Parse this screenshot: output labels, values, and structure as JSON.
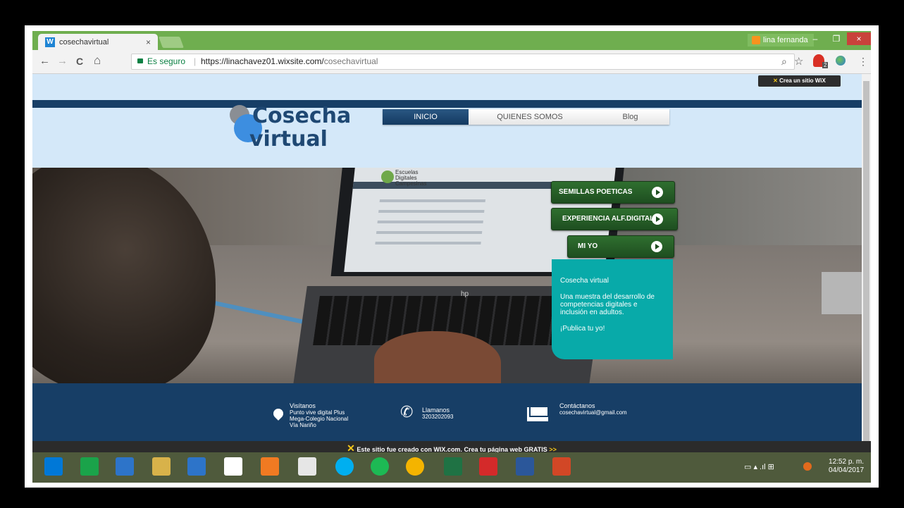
{
  "browser": {
    "tab_title": "cosechavirtual",
    "tab_close": "×",
    "user_name": "lina fernanda",
    "win_min": "–",
    "win_max": "❐",
    "win_close": "×",
    "nav_back": "←",
    "nav_forward": "→",
    "nav_reload": "C",
    "nav_home": "⌂",
    "secure_label": "Es seguro",
    "url_prefix": "https://linachavez01.wixsite.com/",
    "url_path": "cosechavirtual",
    "zoom_icon": "⌕",
    "star_icon": "☆",
    "menu_icon": "⋮",
    "ext_badge": "2"
  },
  "site": {
    "wix_pill_prefix": "Crea un sitio ",
    "wix_pill_brand": "WiX",
    "logo_line1": "Cosecha",
    "logo_line2": "virtual",
    "menu": [
      "INICIO",
      "QUIENES SOMOS",
      "Blog"
    ],
    "buttons": [
      "SEMILLAS POETICAS",
      "EXPERIENCIA ALF.DIGITAL",
      "MI YO"
    ],
    "teal": {
      "title": "Cosecha virtual",
      "body": "Una muestra del desarrollo de competencias digitales e inclusión en adultos.",
      "cta": "¡Publica tu yo!"
    },
    "hero_screen_logo": "Escuelas Digitales Campesinas",
    "hero_hp": "hp",
    "footer": {
      "visit_title": "Visítanos",
      "visit_lines": [
        "Punto vive digital Plus",
        "Mega-Colegio Nacional",
        "Vía Nariño"
      ],
      "call_title": "Llamanos",
      "phone": "3203202093",
      "contact_title": "Contáctanos",
      "email": "cosechavirtual@gmail.com"
    },
    "wix_banner": "Este sitio fue creado con WIX.com. Crea tu página web GRATIS",
    "wix_arrow": ">>"
  },
  "taskbar": {
    "time": "12:52 p. m.",
    "date": "04/04/2017",
    "icons": [
      "windows-start-icon",
      "store-icon",
      "computer-icon",
      "file-explorer-icon",
      "maxthon-icon",
      "home-icon",
      "media-player-icon",
      "tool-icon",
      "skype-icon",
      "spotify-icon",
      "chrome-icon",
      "excel-icon",
      "acrobat-icon",
      "word-icon",
      "powerpoint-icon"
    ],
    "colors": [
      "#0078d7",
      "#1aa34a",
      "#2d74c9",
      "#d8b24a",
      "#2d74c9",
      "#ffffff",
      "#f07a22",
      "#e6e6e6",
      "#00aff0",
      "#1db954",
      "#f4b400",
      "#1f7244",
      "#d42a2a",
      "#2b579a",
      "#d24726"
    ]
  }
}
